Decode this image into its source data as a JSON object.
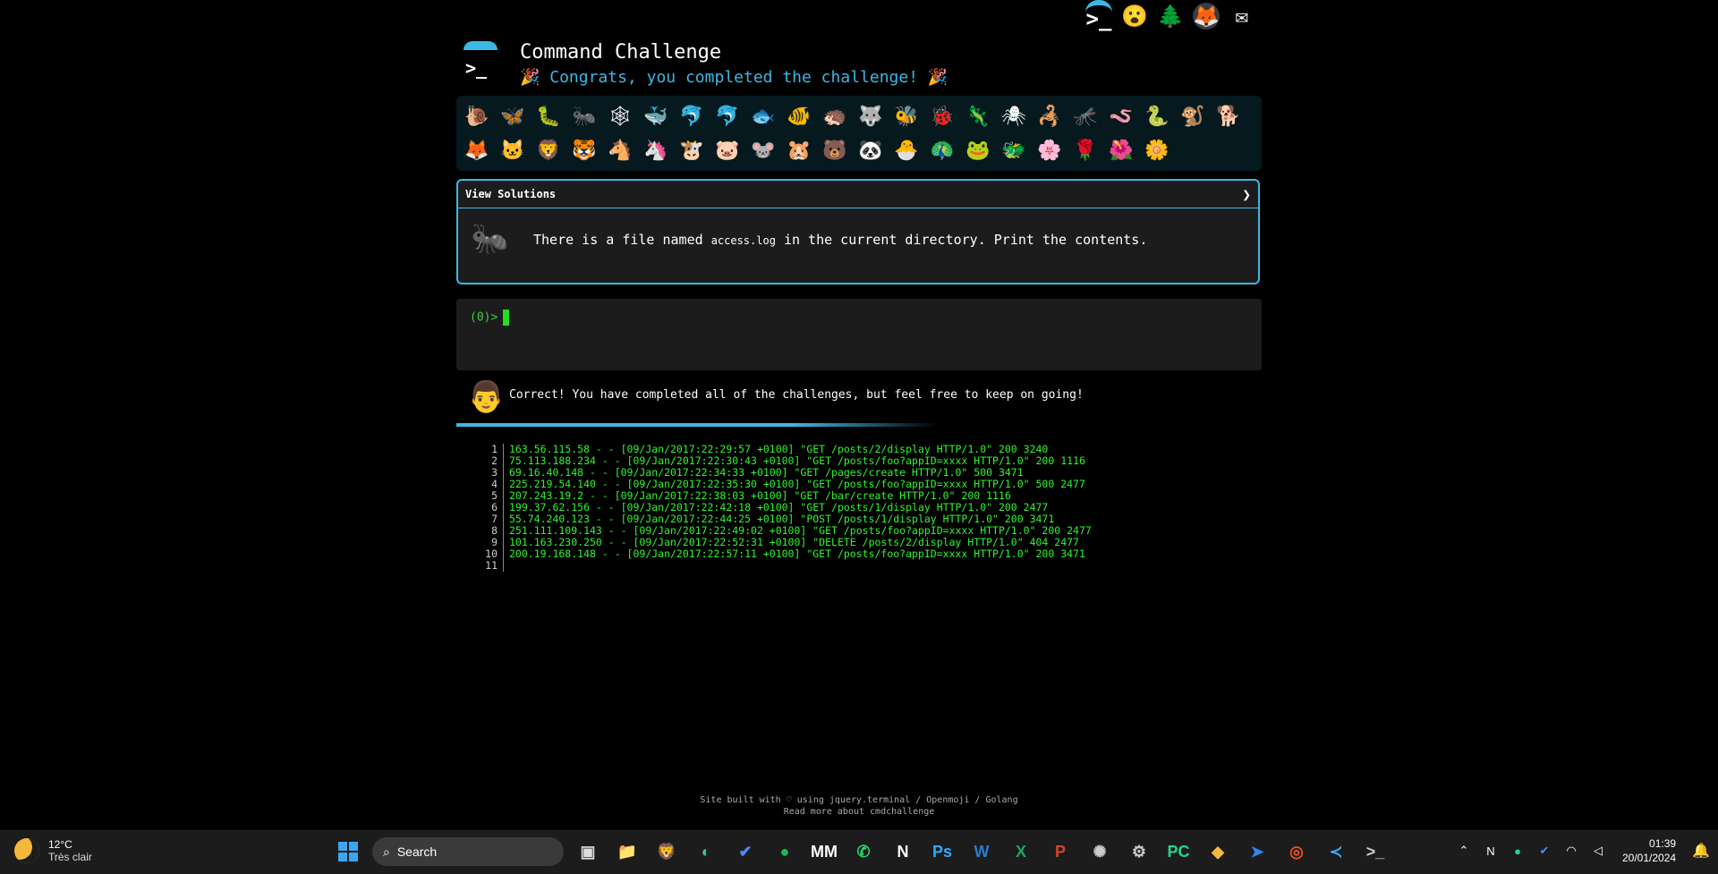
{
  "top_icons": [
    {
      "name": "terminal-icon",
      "glyph": ">_"
    },
    {
      "name": "emoji-face-icon",
      "glyph": "😮"
    },
    {
      "name": "tree-icon",
      "glyph": "🌲"
    },
    {
      "name": "gitlab-fox-icon",
      "glyph": "🦊"
    },
    {
      "name": "mail-icon",
      "glyph": "✉"
    }
  ],
  "header": {
    "title": "Command Challenge",
    "subtitle": "🎉 Congrats, you completed the challenge! 🎉"
  },
  "emoji_rows": [
    [
      "🐌",
      "🦋",
      "🐛",
      "🐜",
      "🕸",
      "🐳",
      "🐬",
      "🐬",
      "🐟",
      "🐠",
      "🦔",
      "🐺",
      "🐝",
      "🐞",
      "🦎",
      "🕷",
      "🦂",
      "🦟",
      "🪱",
      "🐍",
      "🐒",
      "🐕"
    ],
    [
      "🦊",
      "🐱",
      "🦁",
      "🐯",
      "🐴",
      "🦄",
      "🐮",
      "🐷",
      "🐭",
      "🐹",
      "🐻",
      "🐼",
      "🐣",
      "🦚",
      "🐸",
      "🐲",
      "🌸",
      "🌹",
      "🌺",
      "🌼"
    ]
  ],
  "challenge": {
    "view_solutions": "View Solutions",
    "pre": "There is a file named ",
    "code": "access.log",
    "post": " in the current directory. Print the contents.",
    "icon": "🐜"
  },
  "terminal": {
    "prompt": "(0)>"
  },
  "correct": {
    "avatar": "👨",
    "text": "Correct! You have completed all of the challenges, but feel free to keep on going!"
  },
  "log": {
    "numbers": [
      "1",
      "2",
      "3",
      "4",
      "5",
      "6",
      "7",
      "8",
      "9",
      "10",
      "11"
    ],
    "lines": [
      "163.56.115.58 - - [09/Jan/2017:22:29:57 +0100] \"GET /posts/2/display HTTP/1.0\" 200 3240",
      "75.113.188.234 - - [09/Jan/2017:22:30:43 +0100] \"GET /posts/foo?appID=xxxx HTTP/1.0\" 200 1116",
      "69.16.40.148 - - [09/Jan/2017:22:34:33 +0100] \"GET /pages/create HTTP/1.0\" 500 3471",
      "225.219.54.140 - - [09/Jan/2017:22:35:30 +0100] \"GET /posts/foo?appID=xxxx HTTP/1.0\" 500 2477",
      "207.243.19.2 - - [09/Jan/2017:22:38:03 +0100] \"GET /bar/create HTTP/1.0\" 200 1116",
      "199.37.62.156 - - [09/Jan/2017:22:42:18 +0100] \"GET /posts/1/display HTTP/1.0\" 200 2477",
      "55.74.240.123 - - [09/Jan/2017:22:44:25 +0100] \"POST /posts/1/display HTTP/1.0\" 200 3471",
      "251.111.109.143 - - [09/Jan/2017:22:49:02 +0100] \"GET /posts/foo?appID=xxxx HTTP/1.0\" 200 2477",
      "101.163.230.250 - - [09/Jan/2017:22:52:31 +0100] \"DELETE /posts/2/display HTTP/1.0\" 404 2477",
      "200.19.168.148 - - [09/Jan/2017:22:57:11 +0100] \"GET /posts/foo?appID=xxxx HTTP/1.0\" 200 3471",
      ""
    ]
  },
  "footer": {
    "line1": "Site built with ♡ using jquery.terminal / Openmoji / Golang",
    "line2": "Read more about cmdchallenge"
  },
  "taskbar": {
    "weather_temp": "12°C",
    "weather_desc": "Très clair",
    "search_label": "Search",
    "apps": [
      {
        "name": "task-view-icon",
        "glyph": "▣",
        "color": "#ddd"
      },
      {
        "name": "file-explorer-icon",
        "glyph": "📁",
        "color": "#f3c542"
      },
      {
        "name": "brave-icon",
        "glyph": "🦁",
        "color": "#fb542b"
      },
      {
        "name": "edge-icon",
        "glyph": "◐",
        "color": "#35c0a6"
      },
      {
        "name": "todo-icon",
        "glyph": "✔",
        "color": "#4e8cf7"
      },
      {
        "name": "spotify-icon",
        "glyph": "●",
        "color": "#1db954"
      },
      {
        "name": "mm-icon",
        "glyph": "MM",
        "color": "#fff"
      },
      {
        "name": "whatsapp-icon",
        "glyph": "✆",
        "color": "#25d366"
      },
      {
        "name": "notion-icon",
        "glyph": "N",
        "color": "#fff"
      },
      {
        "name": "photoshop-icon",
        "glyph": "Ps",
        "color": "#31a8ff"
      },
      {
        "name": "word-icon",
        "glyph": "W",
        "color": "#2b7cd3"
      },
      {
        "name": "excel-icon",
        "glyph": "X",
        "color": "#21a366"
      },
      {
        "name": "powerpoint-icon",
        "glyph": "P",
        "color": "#d24726"
      },
      {
        "name": "chatgpt-icon",
        "glyph": "✺",
        "color": "#ccc"
      },
      {
        "name": "settings-app-icon",
        "glyph": "⚙",
        "color": "#ccc"
      },
      {
        "name": "pycharm-icon",
        "glyph": "PC",
        "color": "#21d789"
      },
      {
        "name": "git-icon",
        "glyph": "◆",
        "color": "#f7b93e"
      },
      {
        "name": "power-automate-icon",
        "glyph": "➤",
        "color": "#2d87f0"
      },
      {
        "name": "ubuntu-icon",
        "glyph": "◎",
        "color": "#e95420"
      },
      {
        "name": "vscode-icon",
        "glyph": "≺",
        "color": "#3ea6f0"
      },
      {
        "name": "terminal-app-icon",
        "glyph": ">_",
        "color": "#ccc"
      }
    ],
    "time": "01:39",
    "date": "20/01/2024"
  }
}
